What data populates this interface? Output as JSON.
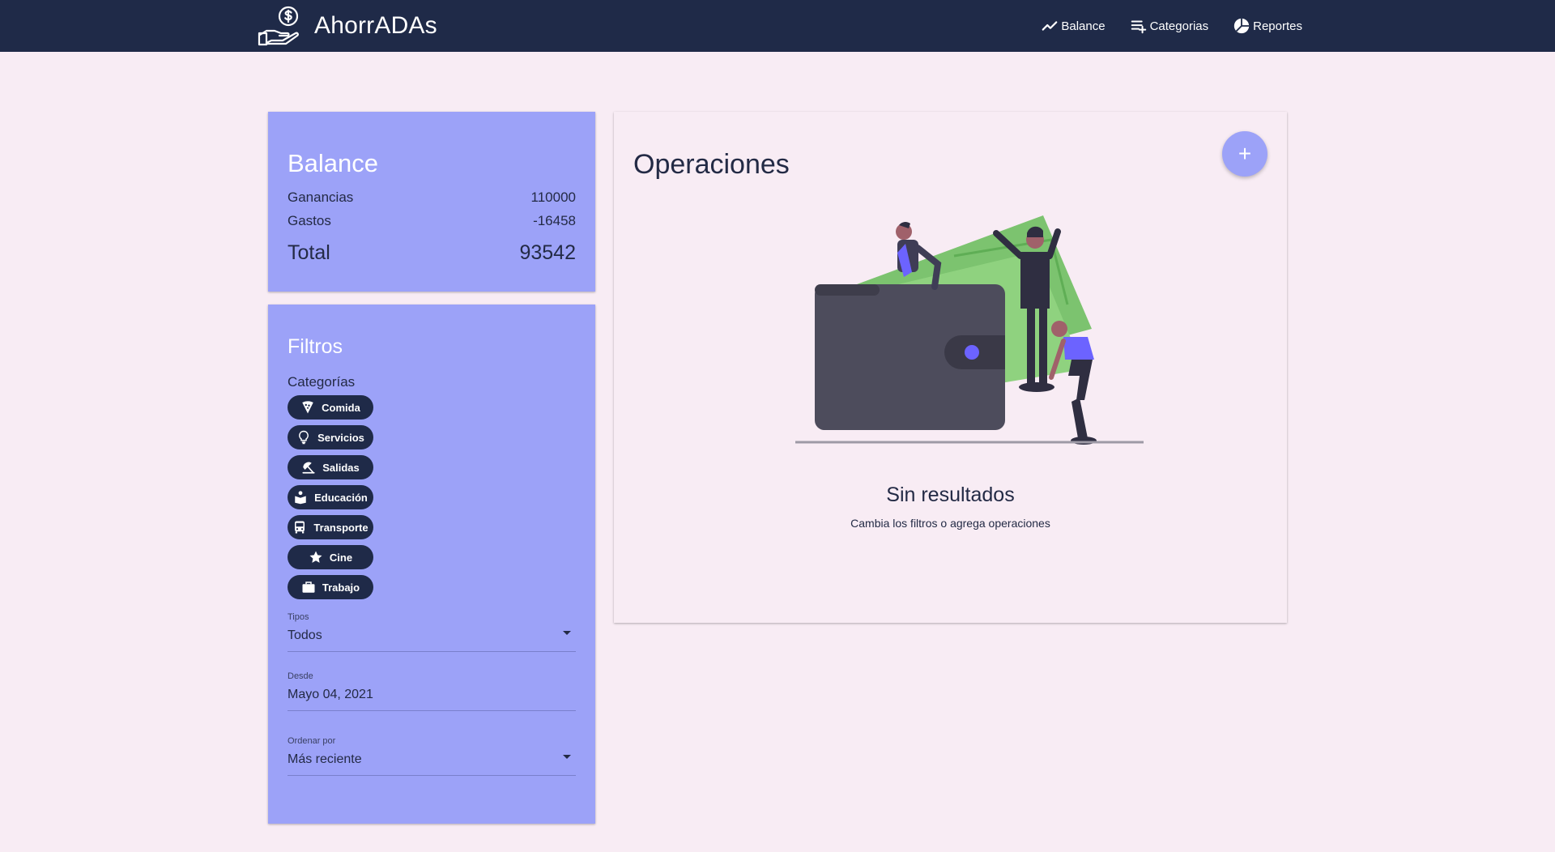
{
  "app": {
    "name": "AhorrADAs",
    "logo_icon": "hand-money-icon"
  },
  "nav": [
    {
      "label": "Balance",
      "icon": "chart-line-icon"
    },
    {
      "label": "Categorias",
      "icon": "playlist-add-icon"
    },
    {
      "label": "Reportes",
      "icon": "pie-chart-icon"
    }
  ],
  "balance": {
    "title": "Balance",
    "earnings_label": "Ganancias",
    "earnings_value": "110000",
    "expenses_label": "Gastos",
    "expenses_value": "-16458",
    "total_label": "Total",
    "total_value": "93542"
  },
  "filters": {
    "title": "Filtros",
    "categories_label": "Categorías",
    "categories": [
      {
        "label": "Comida",
        "icon": "pizza-icon"
      },
      {
        "label": "Servicios",
        "icon": "lightbulb-icon"
      },
      {
        "label": "Salidas",
        "icon": "umbrella-beach-icon"
      },
      {
        "label": "Educación",
        "icon": "book-reader-icon"
      },
      {
        "label": "Transporte",
        "icon": "bus-icon"
      },
      {
        "label": "Cine",
        "icon": "star-icon"
      },
      {
        "label": "Trabajo",
        "icon": "briefcase-icon"
      }
    ],
    "type_label": "Tipos",
    "type_value": "Todos",
    "from_label": "Desde",
    "from_value": "Mayo 04, 2021",
    "order_label": "Ordenar por",
    "order_value": "Más reciente"
  },
  "operations": {
    "title": "Operaciones",
    "add_button": "+",
    "empty_title": "Sin resultados",
    "empty_subtitle": "Cambia los filtros o agrega operaciones"
  },
  "colors": {
    "navbar": "#1f2a48",
    "background": "#f8ecf4",
    "card_accent": "#9ca2f8",
    "chip": "#1f2a48",
    "money_green": "#7cc36f"
  }
}
